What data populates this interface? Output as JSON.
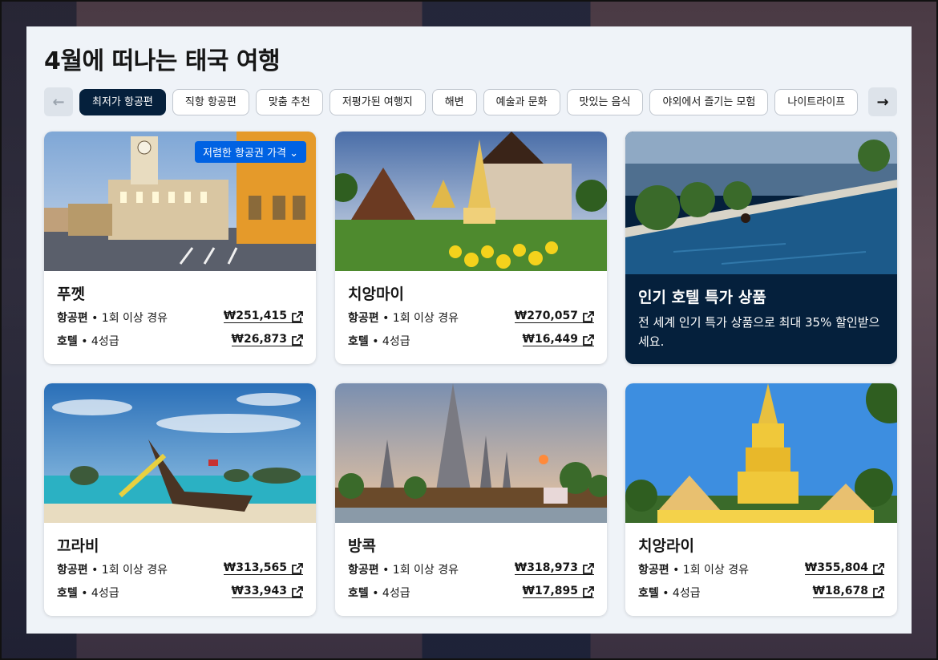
{
  "page": {
    "title": "4월에 떠나는 태국 여행"
  },
  "chips": [
    {
      "label": "최저가 항공편",
      "active": true
    },
    {
      "label": "직항 항공편"
    },
    {
      "label": "맞춤 추천"
    },
    {
      "label": "저평가된 여행지"
    },
    {
      "label": "해변"
    },
    {
      "label": "예술과 문화"
    },
    {
      "label": "맛있는 음식"
    },
    {
      "label": "야외에서 즐기는 모험"
    },
    {
      "label": "나이트라이프"
    }
  ],
  "nav": {
    "prev": "←",
    "next": "→"
  },
  "badge_label": "저렴한 항공권 가격 ⌄",
  "destinations": [
    {
      "name": "푸껫",
      "flight_label": "항공편",
      "flight_detail": " • 1회 이상 경유",
      "flight_price": "₩251,415",
      "hotel_label": "호텔",
      "hotel_detail": " • 4성급",
      "hotel_price": "₩26,873"
    },
    {
      "name": "치앙마이",
      "flight_label": "항공편",
      "flight_detail": " • 1회 이상 경유",
      "flight_price": "₩270,057",
      "hotel_label": "호텔",
      "hotel_detail": " • 4성급",
      "hotel_price": "₩16,449"
    },
    {
      "name": "끄라비",
      "flight_label": "항공편",
      "flight_detail": " • 1회 이상 경유",
      "flight_price": "₩313,565",
      "hotel_label": "호텔",
      "hotel_detail": " • 4성급",
      "hotel_price": "₩33,943"
    },
    {
      "name": "방콕",
      "flight_label": "항공편",
      "flight_detail": " • 1회 이상 경유",
      "flight_price": "₩318,973",
      "hotel_label": "호텔",
      "hotel_detail": " • 4성급",
      "hotel_price": "₩17,895"
    },
    {
      "name": "치앙라이",
      "flight_label": "항공편",
      "flight_detail": " • 1회 이상 경유",
      "flight_price": "₩355,804",
      "hotel_label": "호텔",
      "hotel_detail": " • 4성급",
      "hotel_price": "₩18,678"
    }
  ],
  "promo": {
    "title": "인기 호텔 특가 상품",
    "description": "전 세계 인기 특가 상품으로 최대 35% 할인받으세요."
  },
  "colors": {
    "brand_dark": "#05203c",
    "accent_blue": "#0062e3",
    "panel_bg": "#eff3f8"
  }
}
